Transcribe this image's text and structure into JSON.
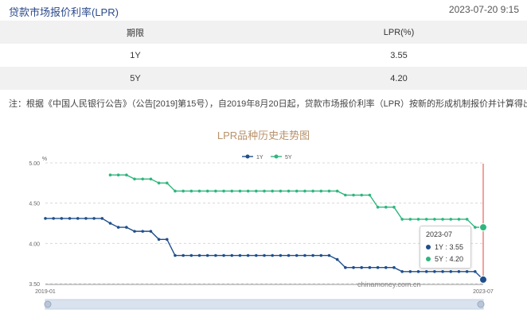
{
  "header": {
    "title": "贷款市场报价利率(LPR)",
    "timestamp": "2023-07-20 9:15"
  },
  "table": {
    "headers": [
      "期限",
      "LPR(%)"
    ],
    "rows": [
      [
        "1Y",
        "3.55"
      ],
      [
        "5Y",
        "4.20"
      ]
    ]
  },
  "note": "注：根据《中国人民银行公告》（公告[2019]第15号），自2019年8月20日起，贷款市场报价利率（LPR）按新的形成机制报价并计算得出。",
  "chart_data": {
    "type": "line",
    "title": "LPR品种历史走势图",
    "ylabel": "%",
    "ylim": [
      3.5,
      5.0
    ],
    "yticks": [
      3.5,
      4.0,
      4.5,
      5.0
    ],
    "ytick_labels": [
      "3.50",
      "4.00",
      "4.50",
      "5.00"
    ],
    "xlim": [
      "2019-01",
      "2023-07"
    ],
    "xtick_labels": [
      "2019-01",
      "2023-07"
    ],
    "legend_position": "top-center",
    "grid": true,
    "x": [
      "2019-01",
      "2019-02",
      "2019-03",
      "2019-04",
      "2019-05",
      "2019-06",
      "2019-07",
      "2019-08",
      "2019-09",
      "2019-10",
      "2019-11",
      "2019-12",
      "2020-01",
      "2020-02",
      "2020-03",
      "2020-04",
      "2020-05",
      "2020-06",
      "2020-07",
      "2020-08",
      "2020-09",
      "2020-10",
      "2020-11",
      "2020-12",
      "2021-01",
      "2021-02",
      "2021-03",
      "2021-04",
      "2021-05",
      "2021-06",
      "2021-07",
      "2021-08",
      "2021-09",
      "2021-10",
      "2021-11",
      "2021-12",
      "2022-01",
      "2022-02",
      "2022-03",
      "2022-04",
      "2022-05",
      "2022-06",
      "2022-07",
      "2022-08",
      "2022-09",
      "2022-10",
      "2022-11",
      "2022-12",
      "2023-01",
      "2023-02",
      "2023-03",
      "2023-04",
      "2023-05",
      "2023-06",
      "2023-07"
    ],
    "series": [
      {
        "name": "1Y",
        "color": "#1f4e8c",
        "values": [
          4.31,
          4.31,
          4.31,
          4.31,
          4.31,
          4.31,
          4.31,
          4.31,
          4.25,
          4.2,
          4.2,
          4.15,
          4.15,
          4.15,
          4.05,
          4.05,
          3.85,
          3.85,
          3.85,
          3.85,
          3.85,
          3.85,
          3.85,
          3.85,
          3.85,
          3.85,
          3.85,
          3.85,
          3.85,
          3.85,
          3.85,
          3.85,
          3.85,
          3.85,
          3.85,
          3.85,
          3.8,
          3.7,
          3.7,
          3.7,
          3.7,
          3.7,
          3.7,
          3.7,
          3.65,
          3.65,
          3.65,
          3.65,
          3.65,
          3.65,
          3.65,
          3.65,
          3.65,
          3.65,
          3.55
        ]
      },
      {
        "name": "5Y",
        "color": "#2eb67d",
        "values": [
          null,
          null,
          null,
          null,
          null,
          null,
          null,
          null,
          4.85,
          4.85,
          4.85,
          4.8,
          4.8,
          4.8,
          4.75,
          4.75,
          4.65,
          4.65,
          4.65,
          4.65,
          4.65,
          4.65,
          4.65,
          4.65,
          4.65,
          4.65,
          4.65,
          4.65,
          4.65,
          4.65,
          4.65,
          4.65,
          4.65,
          4.65,
          4.65,
          4.65,
          4.65,
          4.6,
          4.6,
          4.6,
          4.6,
          4.45,
          4.45,
          4.45,
          4.3,
          4.3,
          4.3,
          4.3,
          4.3,
          4.3,
          4.3,
          4.3,
          4.3,
          4.2,
          4.2
        ]
      }
    ],
    "marker_color": "#e8403a",
    "watermark": "chinamoney.com.cn",
    "tooltip": {
      "date": "2023-07",
      "items": [
        {
          "name": "1Y",
          "value": "3.55"
        },
        {
          "name": "5Y",
          "value": "4.20"
        }
      ]
    }
  }
}
